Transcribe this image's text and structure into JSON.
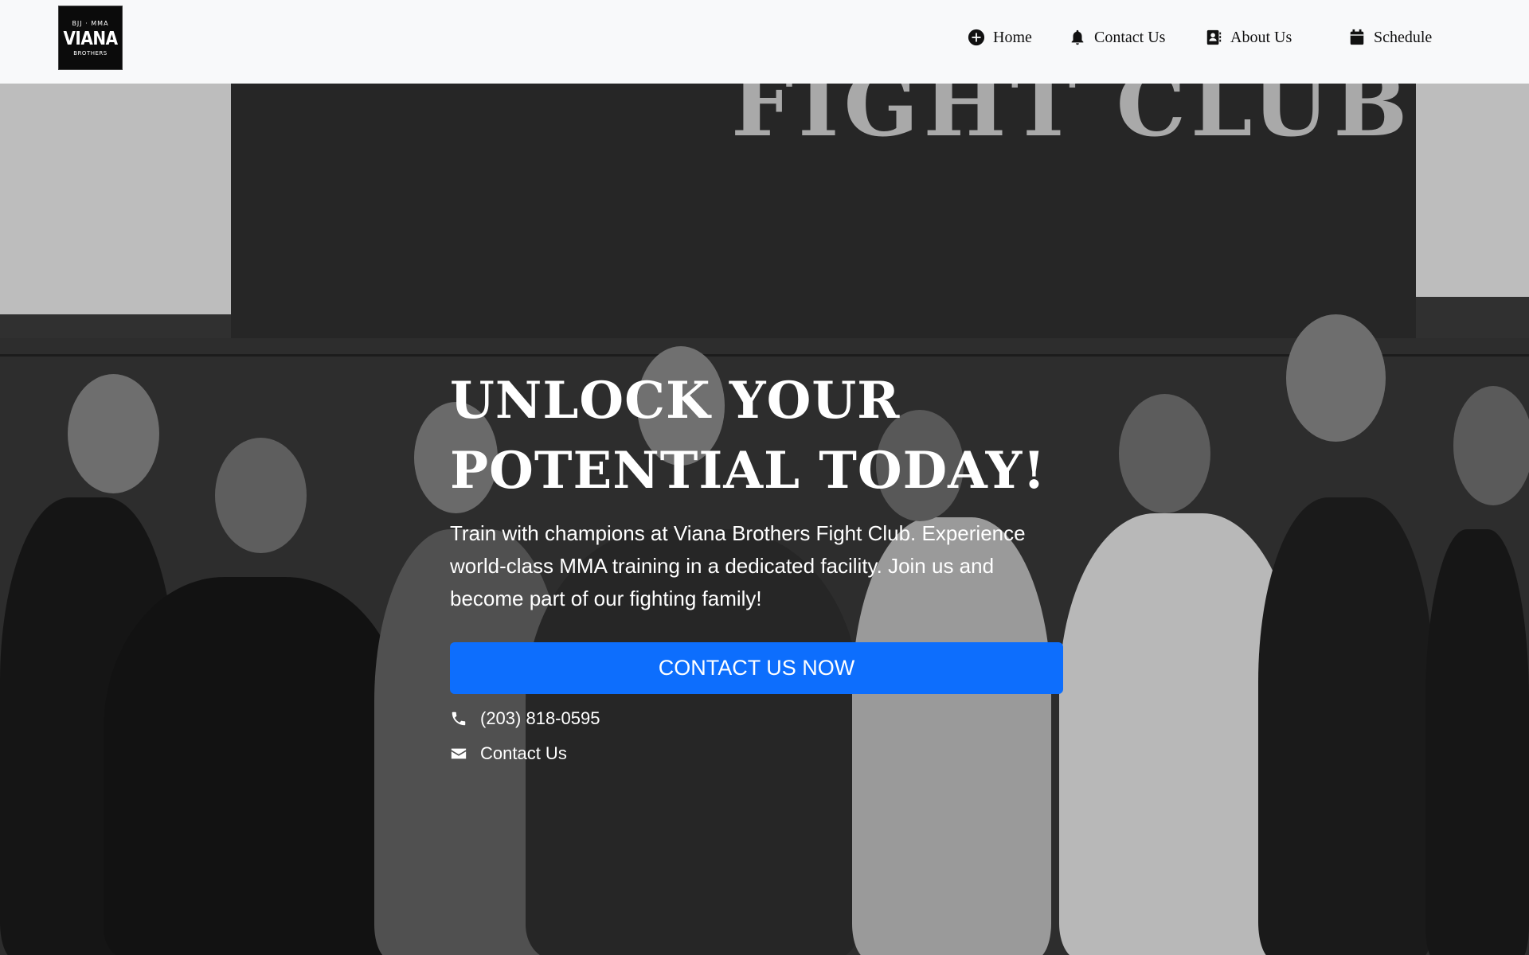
{
  "logo": {
    "top_text": "BJJ · MMA",
    "main_text": "VIANA",
    "sub_text": "BROTHERS"
  },
  "nav": {
    "items": [
      {
        "label": "Home",
        "icon": "plus-circle-icon"
      },
      {
        "label": "Contact Us",
        "icon": "bell-icon"
      },
      {
        "label": "About Us",
        "icon": "contact-book-icon"
      },
      {
        "label": "Schedule",
        "icon": "calendar-icon"
      }
    ]
  },
  "hero": {
    "background_sign": "FIGHT CLUB",
    "title": "UNLOCK YOUR\nPOTENTIAL TODAY!",
    "description": "Train with champions at Viana Brothers Fight Club. Experience world-class MMA training in a dedicated facility. Join us and become part of our fighting family!",
    "cta_label": "CONTACT US NOW",
    "phone": "(203) 818-0595",
    "email_label": "Contact Us"
  },
  "colors": {
    "navbar_bg": "#f8f9fa",
    "cta_bg": "#0d6efd"
  }
}
